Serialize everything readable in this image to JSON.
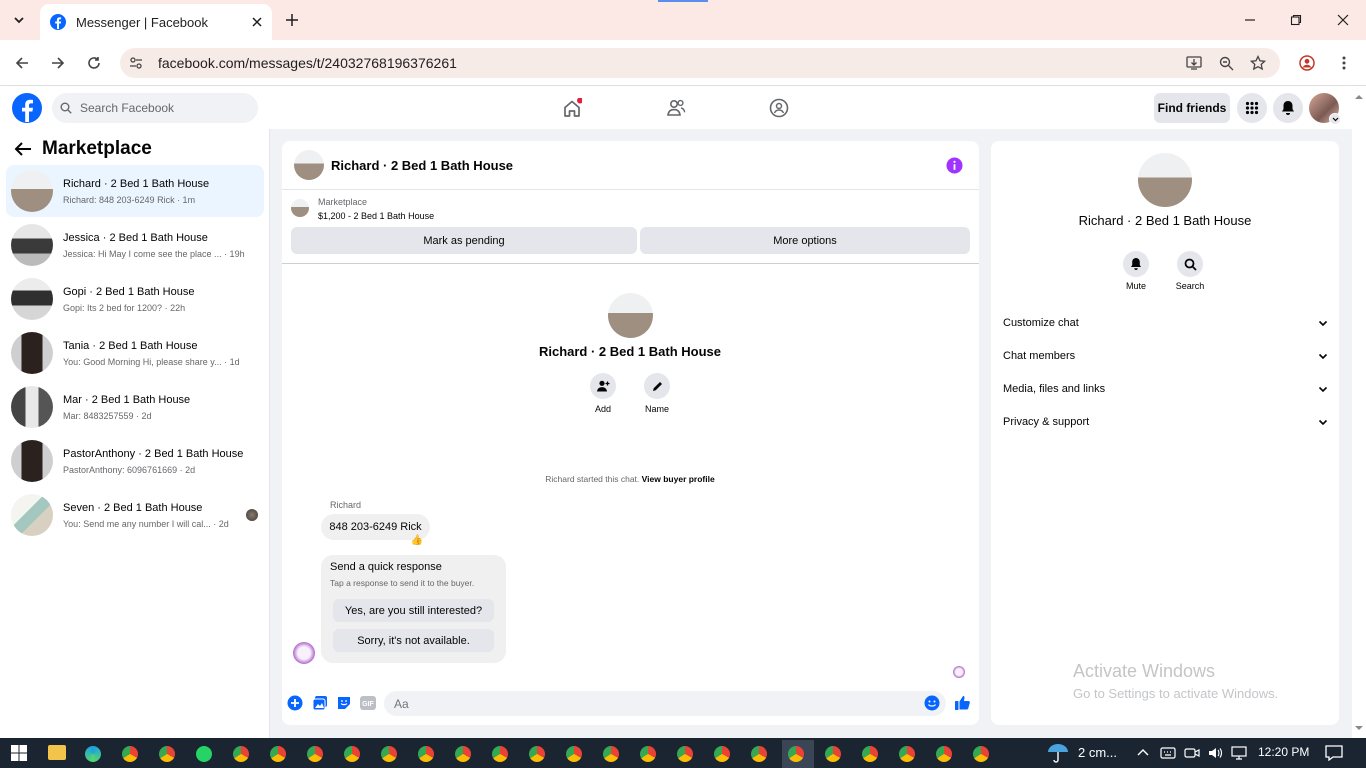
{
  "browser": {
    "tab_title": "Messenger | Facebook",
    "url": "facebook.com/messages/t/24032768196376261"
  },
  "fb_header": {
    "search_placeholder": "Search Facebook",
    "find_friends": "Find friends"
  },
  "left_panel": {
    "title": "Marketplace",
    "conversations": [
      {
        "name": "Richard · 2 Bed 1 Bath House",
        "preview": "Richard: 848 203-6249 Rick · 1m",
        "active": true
      },
      {
        "name": "Jessica · 2 Bed 1 Bath House",
        "preview": "Jessica: Hi May I come see the place ... · 19h"
      },
      {
        "name": "Gopi · 2 Bed 1 Bath House",
        "preview": "Gopi: Its 2 bed for 1200? · 22h"
      },
      {
        "name": "Tania · 2 Bed 1 Bath House",
        "preview": "You: Good Morning Hi, please share y... · 1d"
      },
      {
        "name": "Mar · 2 Bed 1 Bath House",
        "preview": "Mar: 8483257559 · 2d"
      },
      {
        "name": "PastorAnthony · 2 Bed 1 Bath House",
        "preview": "PastorAnthony: 6096761669 · 2d"
      },
      {
        "name": "Seven · 2 Bed 1 Bath House",
        "preview": "You: Send me any number I will cal... · 2d"
      }
    ]
  },
  "chat": {
    "title": "Richard · 2 Bed 1 Bath House",
    "listing_source": "Marketplace",
    "listing_title": "$1,200 - 2 Bed 1 Bath House",
    "mark_pending": "Mark as pending",
    "more_options": "More options",
    "profile_name": "Richard · 2 Bed 1 Bath House",
    "add_label": "Add",
    "name_label": "Name",
    "started_text": "Richard started this chat.",
    "view_buyer": "View buyer profile",
    "sender": "Richard",
    "message": "848 203-6249 Rick",
    "reaction": "👍",
    "quick_title": "Send a quick response",
    "quick_sub": "Tap a response to send it to the buyer.",
    "quick_1": "Yes, are you still interested?",
    "quick_2": "Sorry, it's not available.",
    "composer_placeholder": "Aa"
  },
  "right_panel": {
    "name": "Richard · 2 Bed 1 Bath House",
    "mute": "Mute",
    "search": "Search",
    "sections": [
      "Customize chat",
      "Chat members",
      "Media, files and links",
      "Privacy & support"
    ]
  },
  "watermark": {
    "line1": "Activate Windows",
    "line2": "Go to Settings to activate Windows."
  },
  "taskbar": {
    "weather": "2 cm...",
    "time": "12:20 PM"
  },
  "colors": {
    "fb_blue": "#0866ff",
    "messenger_purple": "#a033ff",
    "active_row": "#ebf5ff"
  }
}
